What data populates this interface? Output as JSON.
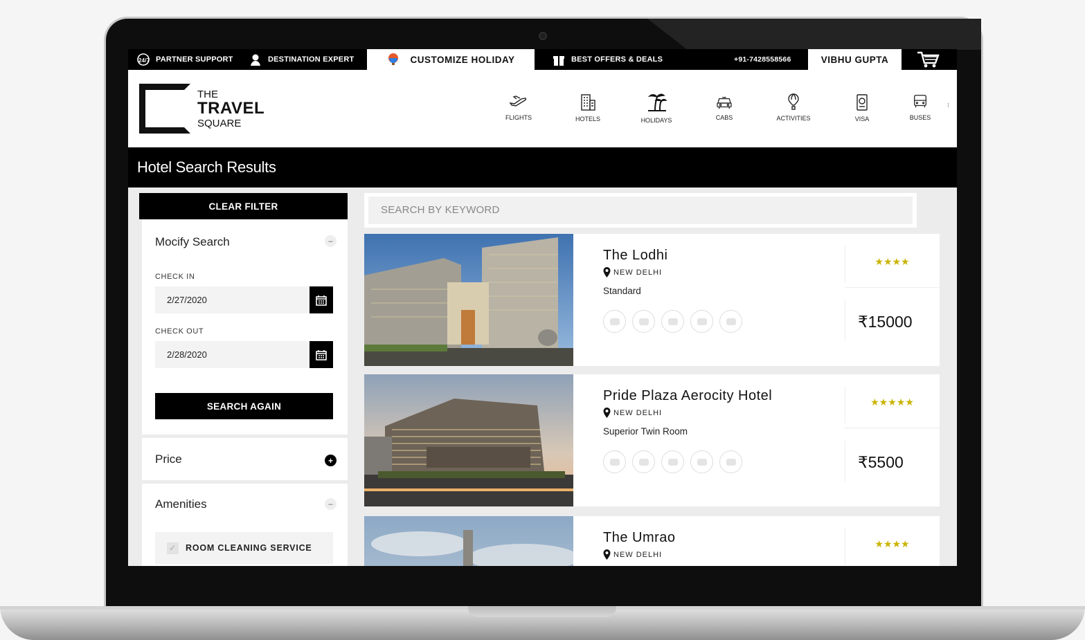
{
  "topbar": {
    "partner_support": "PARTNER SUPPORT",
    "destination_expert": "DESTINATION EXPERT",
    "customize_holiday": "CUSTOMIZE HOLIDAY",
    "best_offers": "BEST OFFERS & DEALS",
    "phone": "+91-7428558566",
    "user_name": "VIBHU GUPTA"
  },
  "logo": {
    "line1": "THE",
    "line2": "TRAVEL",
    "line3": "SQUARE"
  },
  "nav": [
    {
      "label": "FLIGHTS",
      "icon": "plane-icon"
    },
    {
      "label": "HOTELS",
      "icon": "hotel-icon"
    },
    {
      "label": "HOLIDAYS",
      "icon": "palm-tree-icon"
    },
    {
      "label": "CABS",
      "icon": "car-icon"
    },
    {
      "label": "ACTIVITIES",
      "icon": "balloon-icon"
    },
    {
      "label": "VISA",
      "icon": "passport-icon"
    },
    {
      "label": "BUSES",
      "icon": "bus-icon"
    }
  ],
  "page_title": "Hotel Search Results",
  "sidebar": {
    "clear_filter": "CLEAR FILTER",
    "modify_title": "Mocify Search",
    "check_in_label": "CHECK IN",
    "check_in_value": "2/27/2020",
    "check_out_label": "CHECK OUT",
    "check_out_value": "2/28/2020",
    "search_again": "SEARCH AGAIN",
    "price_title": "Price",
    "amenities_title": "Amenities",
    "amenity_option": "ROOM CLEANING SERVICE"
  },
  "search": {
    "placeholder": "SEARCH BY KEYWORD"
  },
  "hotels": [
    {
      "name": "The Lodhi",
      "location": "NEW DELHI",
      "room": "Standard",
      "stars": "★★★★",
      "price": "₹15000"
    },
    {
      "name": "Pride Plaza Aerocity Hotel",
      "location": "NEW DELHI",
      "room": "Superior Twin Room",
      "stars": "★★★★★",
      "price": "₹5500"
    },
    {
      "name": "The Umrao",
      "location": "NEW DELHI",
      "room": "",
      "stars": "★★★★",
      "price": ""
    }
  ],
  "amenity_icons": [
    "wifi-icon",
    "dining-icon",
    "spa-icon",
    "gym-icon",
    "pool-icon"
  ],
  "colors": {
    "primary": "#000000",
    "accent_star": "#c9b400",
    "background": "#ececec"
  }
}
